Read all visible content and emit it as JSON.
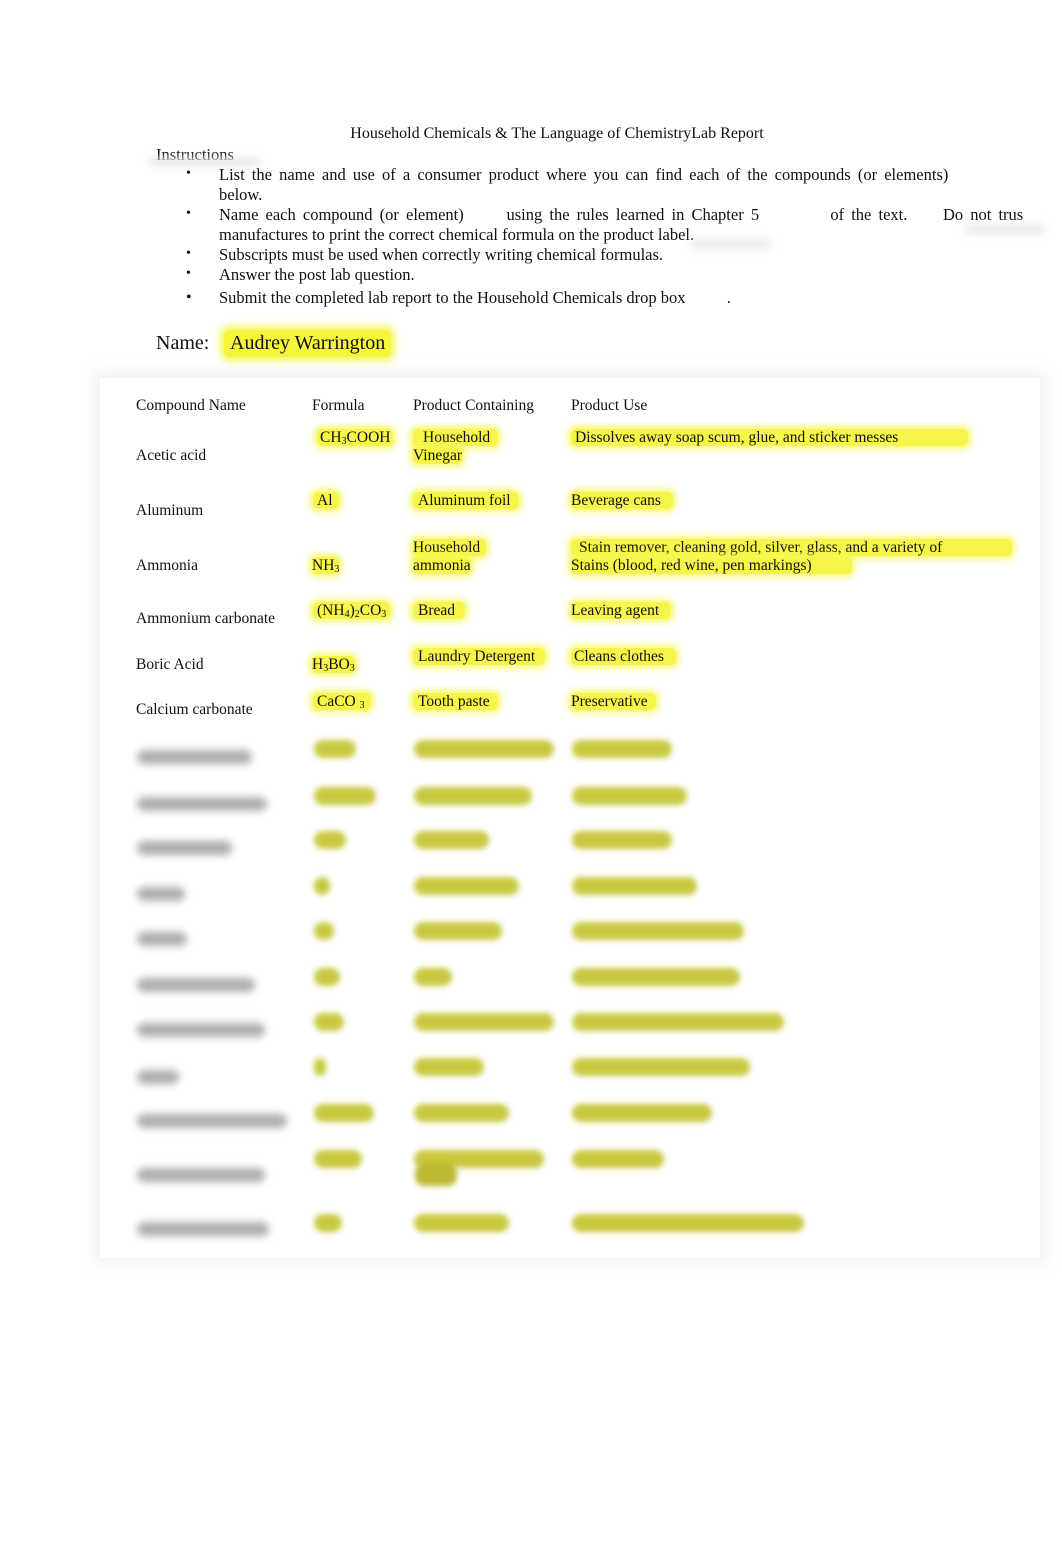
{
  "document": {
    "title": "Household Chemicals & The Language of ChemistryLab Report",
    "instructions_heading": "Instructions",
    "instructions": [
      {
        "bullet": "•",
        "lines": [
          "List the name and use of a consumer product where you can find each of the compounds (or elements)",
          "below."
        ]
      },
      {
        "bullet": "•",
        "lines": [
          "Name each compound (or element)      using the rules learned in Chapter 5          of the text.     Do not trus",
          "manufactures to print the correct chemical formula on the product label."
        ]
      },
      {
        "bullet": "•",
        "lines": [
          "Subscripts must be used when correctly writing chemical formulas."
        ]
      },
      {
        "bullet": "•",
        "lines": [
          "Answer the post lab question."
        ]
      },
      {
        "bullet": "•",
        "lines": [
          "Submit the completed lab report to the Household Chemicals drop box          ."
        ]
      }
    ],
    "name_label": "Name:",
    "name_value": "Audrey Warrington"
  },
  "table": {
    "headers": [
      "Compound Name",
      "Formula",
      "Product Containing",
      "Product Use"
    ],
    "rows": [
      {
        "compound": "Acetic acid",
        "formula": "CH₃COOH",
        "product": [
          "Household",
          "Vinegar"
        ],
        "use": [
          "Dissolves away soap scum, glue, and sticker messes"
        ]
      },
      {
        "compound": "Aluminum",
        "formula": "Al",
        "product": [
          "Aluminum foil"
        ],
        "use": [
          "Beverage cans"
        ]
      },
      {
        "compound": "Ammonia",
        "formula": "NH₃",
        "product": [
          "Household",
          "ammonia"
        ],
        "use": [
          "Stain remover, cleaning gold, silver, glass, and a variety of",
          "Stains (blood, red wine, pen markings)"
        ]
      },
      {
        "compound": "Ammonium carbonate",
        "formula": "(NH₄)₂CO₃",
        "product": [
          "Bread"
        ],
        "use": [
          "Leaving agent"
        ]
      },
      {
        "compound": "Boric Acid",
        "formula": "H₃BO₃",
        "product": [
          "Laundry Detergent"
        ],
        "use": [
          "Cleans clothes"
        ]
      },
      {
        "compound": "Calcium carbonate",
        "formula": "CaCO ₃",
        "product": [
          "Tooth paste"
        ],
        "use": [
          "Preservative"
        ]
      }
    ],
    "obscured_rows_count": 12
  },
  "colors": {
    "highlight": "#f5f53a",
    "text": "#111111",
    "obscured_highlight": "#bfbf1f"
  }
}
